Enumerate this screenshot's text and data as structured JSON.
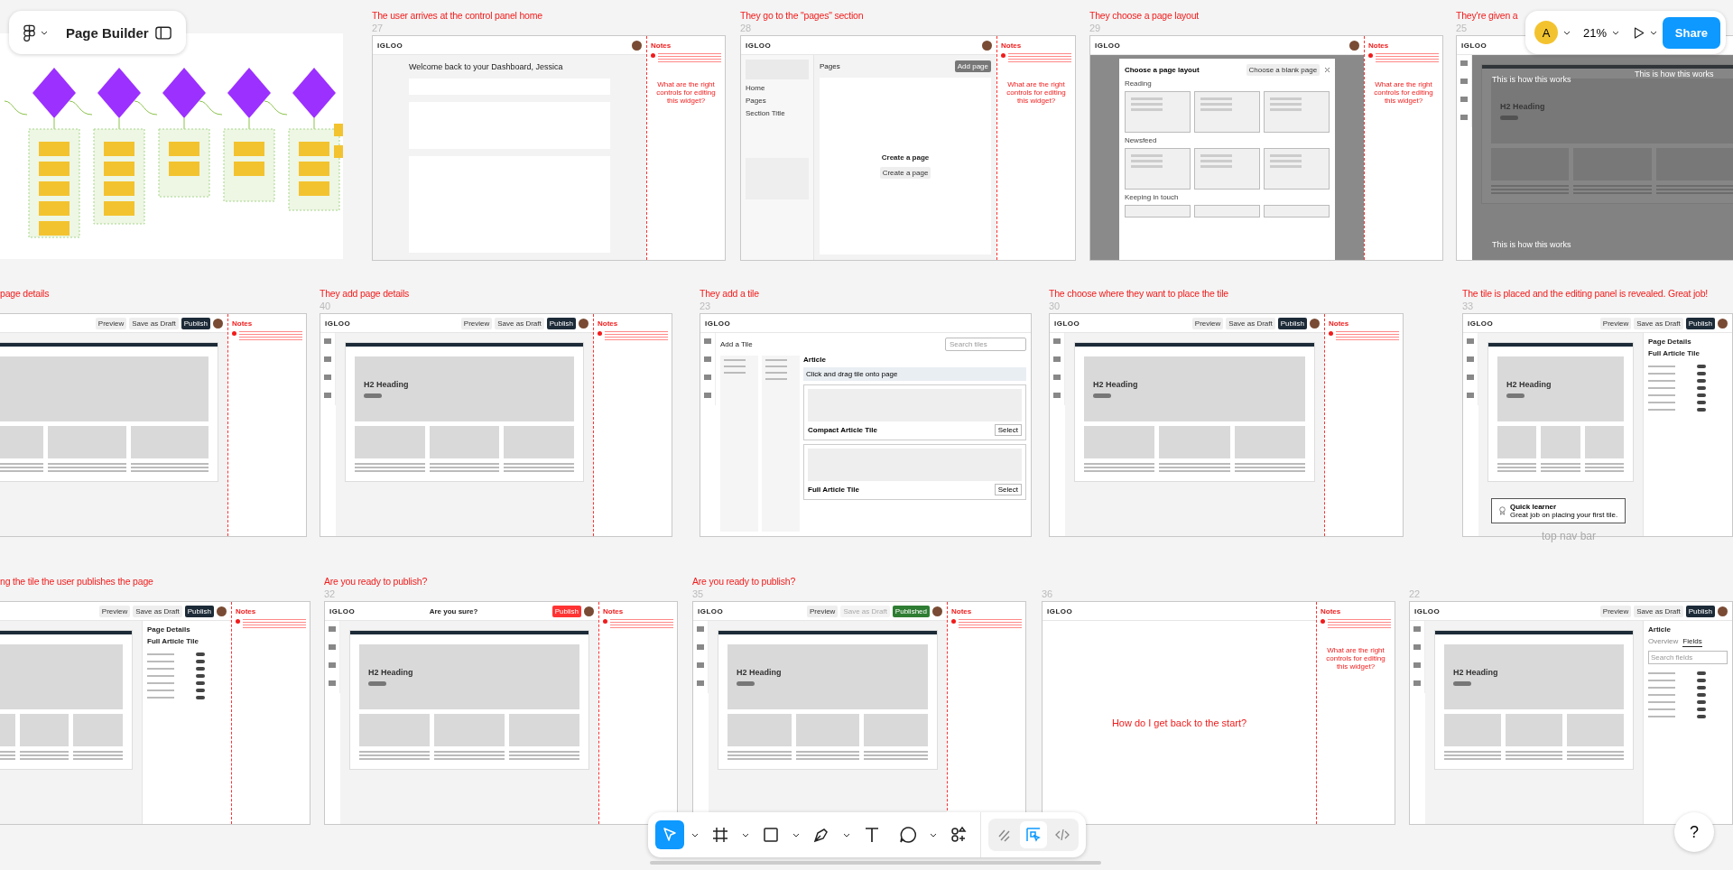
{
  "file": {
    "title": "Page Builder"
  },
  "session": {
    "avatar": "A",
    "zoom": "21%",
    "share": "Share"
  },
  "frames": [
    {
      "kind": "flowchart"
    },
    {
      "kind": "dashboard",
      "label": "The user arrives at the control panel home",
      "number": "27",
      "logo": "IGLOO",
      "heading": "Welcome back to your Dashboard, Jessica",
      "notes": {
        "title": "Notes",
        "question": "What are the right controls for editing this widget?"
      }
    },
    {
      "kind": "pages",
      "label": "They go to the \"pages\" section",
      "number": "28",
      "logo": "IGLOO",
      "nav": [
        "Home",
        "Pages",
        "Section Title"
      ],
      "title": "Pages",
      "add_button": "Add page",
      "empty_title": "Create a page",
      "empty_button": "Create a page",
      "notes": {
        "title": "Notes",
        "question": "What are the right controls for editing this widget?"
      }
    },
    {
      "kind": "layout",
      "label": "They choose a page layout",
      "number": "29",
      "logo": "IGLOO",
      "modal_title": "Choose a page layout",
      "modal_button": "Choose a blank page",
      "sections": [
        "Reading",
        "Newsfeed",
        "Keeping in touch"
      ],
      "notes": {
        "title": "Notes",
        "question": "What are the right controls for editing this widget?"
      }
    },
    {
      "kind": "overlay",
      "label": "They're given a",
      "number": "25",
      "logo": "IGLOO",
      "hero_heading": "H2 Heading",
      "hints": [
        "This is how this works",
        "This is how this works",
        "This is how this works"
      ]
    },
    {
      "kind": "editor",
      "label": "page details",
      "actions": [
        {
          "label": "Preview",
          "kind": "light"
        },
        {
          "label": "Save as Draft",
          "kind": "light"
        },
        {
          "label": "Publish",
          "kind": "dark"
        }
      ],
      "notes": {
        "title": "Notes"
      }
    },
    {
      "kind": "editor",
      "label": "They add page details",
      "number": "40",
      "logo": "IGLOO",
      "actions": [
        {
          "label": "Preview",
          "kind": "light"
        },
        {
          "label": "Save as Draft",
          "kind": "light"
        },
        {
          "label": "Publish",
          "kind": "dark"
        }
      ],
      "hero_heading": "H2 Heading",
      "notes": {
        "title": "Notes"
      }
    },
    {
      "kind": "tiles",
      "label": "They add a tile",
      "number": "23",
      "logo": "IGLOO",
      "panel_title": "Add a Tile",
      "search": "Search tiles",
      "heading": "Article",
      "tip": "Click and drag tile onto page",
      "tiles": [
        {
          "name": "Compact Article Tile",
          "button": "Select"
        },
        {
          "name": "Full Article Tile",
          "button": "Select"
        }
      ]
    },
    {
      "kind": "editor",
      "label": "The choose where they want to place the tile",
      "number": "30",
      "logo": "IGLOO",
      "actions": [
        {
          "label": "Preview",
          "kind": "light"
        },
        {
          "label": "Save as Draft",
          "kind": "light"
        },
        {
          "label": "Publish",
          "kind": "dark"
        }
      ],
      "hero_heading": "H2 Heading",
      "notes": {
        "title": "Notes"
      }
    },
    {
      "kind": "editor",
      "label": "The tile is placed and the editing panel is revealed. Great job!",
      "number": "33",
      "logo": "IGLOO",
      "actions": [
        {
          "label": "Preview",
          "kind": "light"
        },
        {
          "label": "Save as Draft",
          "kind": "light"
        },
        {
          "label": "Publish",
          "kind": "dark"
        }
      ],
      "hero_heading": "H2 Heading",
      "panel": {
        "title": "Page Details",
        "subtitle": "Full Article Tile"
      },
      "toast": {
        "title": "Quick learner",
        "text": "Great job on placing your first tile."
      }
    },
    {
      "kind": "editor",
      "label": "ng the tile the user publishes the page",
      "actions": [
        {
          "label": "Preview",
          "kind": "light"
        },
        {
          "label": "Save as Draft",
          "kind": "light"
        },
        {
          "label": "Publish",
          "kind": "dark"
        }
      ],
      "panel": {
        "title": "Page Details",
        "subtitle": "Full Article Tile"
      },
      "notes": {
        "title": "Notes"
      }
    },
    {
      "kind": "editor",
      "label": "Are you ready to publish?",
      "number": "32",
      "logo": "IGLOO",
      "confirm": "Are you sure?",
      "actions": [
        {
          "label": "Publish",
          "kind": "red"
        }
      ],
      "hero_heading": "H2 Heading",
      "notes": {
        "title": "Notes"
      }
    },
    {
      "kind": "editor",
      "label": "Are you ready to publish?",
      "number": "35",
      "logo": "IGLOO",
      "actions": [
        {
          "label": "Preview",
          "kind": "light"
        },
        {
          "label": "Save as Draft",
          "kind": "muted"
        },
        {
          "label": "Published",
          "kind": "green"
        }
      ],
      "hero_heading": "H2 Heading",
      "notes": {
        "title": "Notes"
      }
    },
    {
      "kind": "blank",
      "number": "36",
      "logo": "IGLOO",
      "center_text": "How do I get back to the start?",
      "notes": {
        "title": "Notes",
        "question": "What are the right controls for editing this widget?"
      }
    },
    {
      "kind": "editor",
      "number": "22",
      "logo": "IGLOO",
      "actions": [
        {
          "label": "Preview",
          "kind": "light"
        },
        {
          "label": "Save as Draft",
          "kind": "light"
        },
        {
          "label": "Publish",
          "kind": "dark"
        }
      ],
      "hero_heading": "H2 Heading",
      "panel": {
        "title": "Article",
        "tabs": [
          {
            "label": "Overview",
            "selected": false
          },
          {
            "label": "Fields",
            "selected": true
          }
        ],
        "search": "Search fields"
      }
    }
  ],
  "canvas_notes": [
    "top nav bar"
  ],
  "toolbar": [
    {
      "kind": "move",
      "selected": true,
      "menu": true
    },
    {
      "kind": "frame",
      "selected": false,
      "menu": true
    },
    {
      "kind": "rectangle",
      "selected": false,
      "menu": true
    },
    {
      "kind": "pen",
      "selected": false,
      "menu": true
    },
    {
      "kind": "text",
      "selected": false,
      "menu": false
    },
    {
      "kind": "comment",
      "selected": false,
      "menu": true
    },
    {
      "kind": "actions",
      "selected": false,
      "menu": false
    }
  ],
  "modes": [
    {
      "kind": "draw",
      "selected": false
    },
    {
      "kind": "design",
      "selected": true
    },
    {
      "kind": "dev",
      "selected": false
    }
  ],
  "help": "?"
}
